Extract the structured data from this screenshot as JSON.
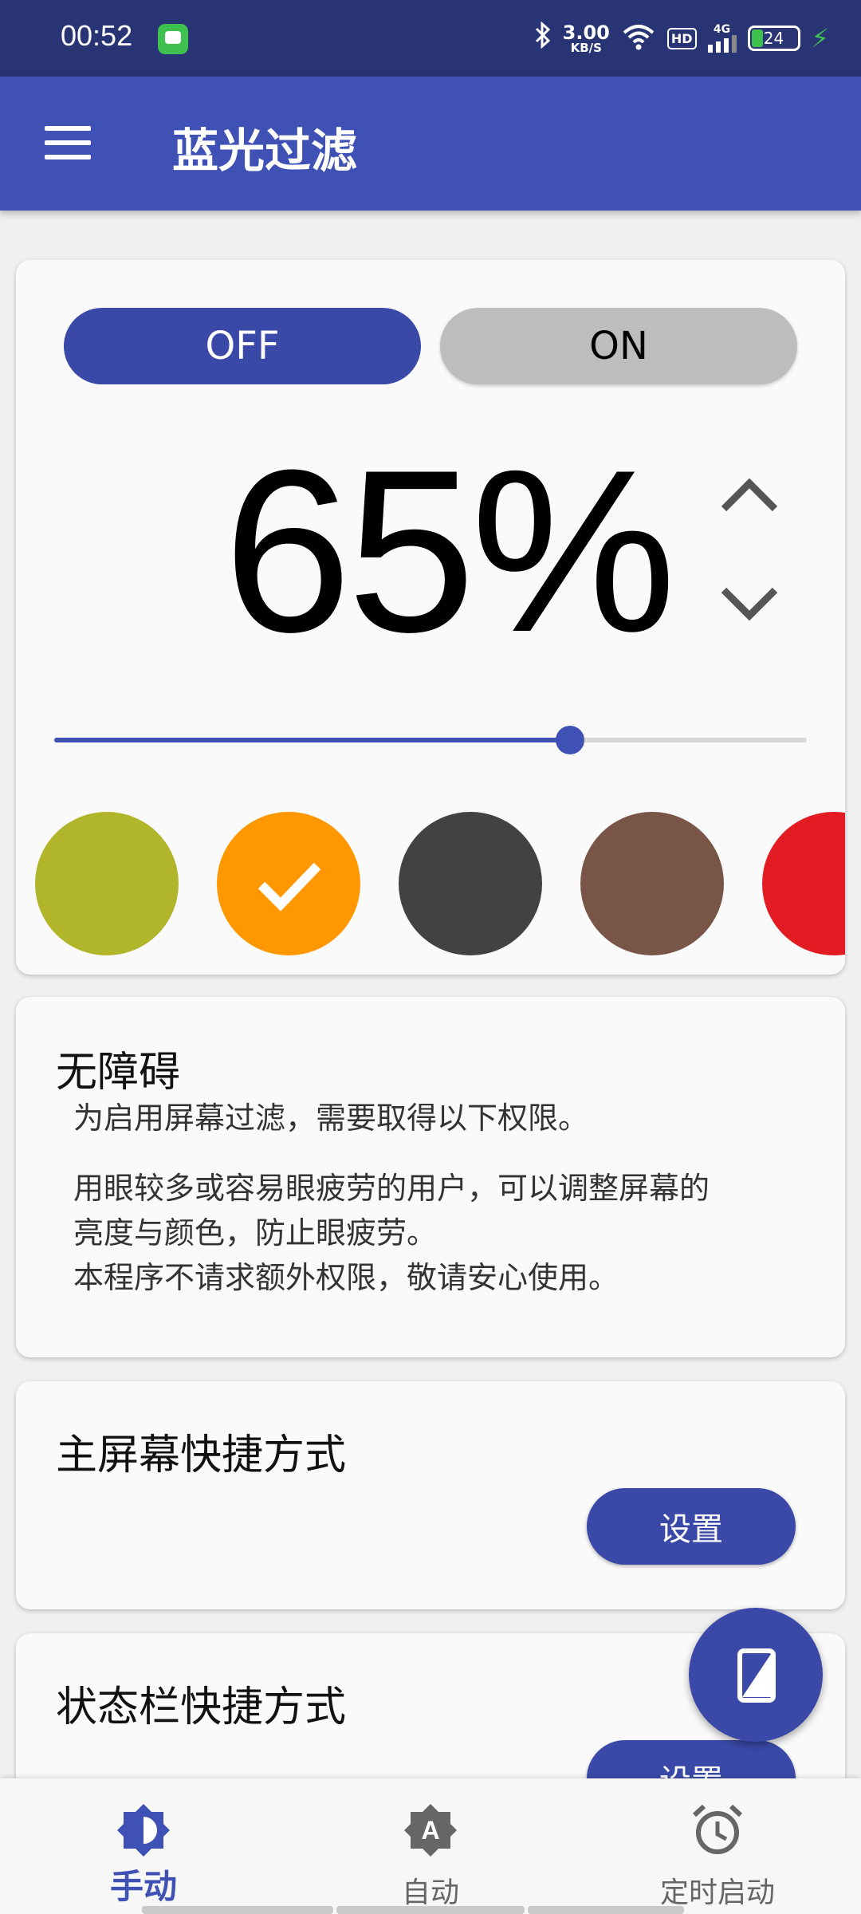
{
  "status_bar": {
    "time": "00:52",
    "net_speed_value": "3.00",
    "net_speed_unit": "KB/S",
    "hd_label": "HD",
    "network_label": "4G",
    "battery": "24"
  },
  "app_bar": {
    "title": "蓝光过滤"
  },
  "filter_card": {
    "off_label": "OFF",
    "on_label": "ON",
    "selected_toggle": "OFF",
    "percent_display": "65%",
    "intensity_level": 0.685,
    "swatches": [
      {
        "name": "olive",
        "color": "#b0b52a",
        "selected": false
      },
      {
        "name": "orange",
        "color": "#ff9800",
        "selected": true
      },
      {
        "name": "dark-gray",
        "color": "#424242",
        "selected": false
      },
      {
        "name": "brown",
        "color": "#795548",
        "selected": false
      },
      {
        "name": "red",
        "color": "#e31c23",
        "selected": false
      }
    ]
  },
  "accessibility_card": {
    "title": "无障碍",
    "line1": "为启用屏幕过滤，需要取得以下权限。",
    "line2": "用眼较多或容易眼疲劳的用户，可以调整屏幕的",
    "line3": "亮度与颜色，防止眼疲劳。",
    "line4": "本程序不请求额外权限，敬请安心使用。"
  },
  "home_shortcut_card": {
    "title": "主屏幕快捷方式",
    "button_label": "设置"
  },
  "status_shortcut_card": {
    "title": "状态栏快捷方式",
    "button_label": "设置"
  },
  "bottom_nav": {
    "items": [
      {
        "label": "手动",
        "icon": "brightness-icon",
        "active": true
      },
      {
        "label": "自动",
        "icon": "auto-brightness-icon",
        "active": false
      },
      {
        "label": "定时启动",
        "icon": "alarm-clock-icon",
        "active": false
      }
    ]
  },
  "colors": {
    "primary": "#3f51b5",
    "primary_dark": "#283474",
    "button": "#3a49a8",
    "toggle_inactive": "#bdbdbd"
  }
}
